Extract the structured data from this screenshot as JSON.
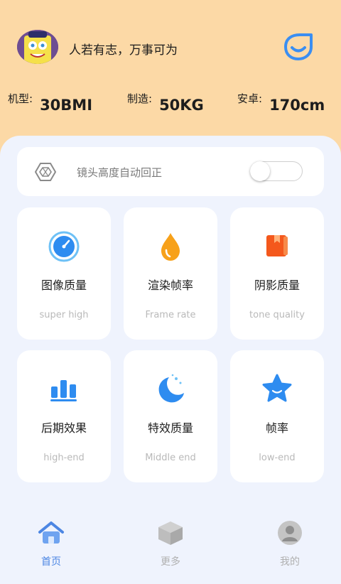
{
  "header": {
    "motto": "人若有志，万事可为",
    "stats": [
      {
        "label": "机型:",
        "value": "30BMI"
      },
      {
        "label": "制造:",
        "value": "50KG"
      },
      {
        "label": "安卓:",
        "value": "170cm"
      }
    ]
  },
  "toggle": {
    "label": "镜头高度自动回正",
    "enabled": false,
    "icon": "hexagon-icon"
  },
  "tiles": [
    {
      "title": "图像质量",
      "subtitle": "super high",
      "icon": "gauge-icon"
    },
    {
      "title": "渲染帧率",
      "subtitle": "Frame rate",
      "icon": "drop-icon"
    },
    {
      "title": "阴影质量",
      "subtitle": "tone quality",
      "icon": "book-icon"
    },
    {
      "title": "后期效果",
      "subtitle": "high-end",
      "icon": "bar-chart-icon"
    },
    {
      "title": "特效质量",
      "subtitle": "Middle end",
      "icon": "moon-icon"
    },
    {
      "title": "帧率",
      "subtitle": "low-end",
      "icon": "star-icon"
    }
  ],
  "tabs": [
    {
      "label": "首页",
      "icon": "home-icon",
      "active": true
    },
    {
      "label": "更多",
      "icon": "cube-icon",
      "active": false
    },
    {
      "label": "我的",
      "icon": "profile-icon",
      "active": false
    }
  ],
  "colors": {
    "header_bg": "#fcd9a6",
    "panel_bg": "#eff3fd",
    "accent_blue": "#2e8cf0",
    "orange": "#f7a11a",
    "red_orange": "#f4581c",
    "active_tab": "#4c86e3",
    "inactive_tab": "#b0b0b0"
  }
}
